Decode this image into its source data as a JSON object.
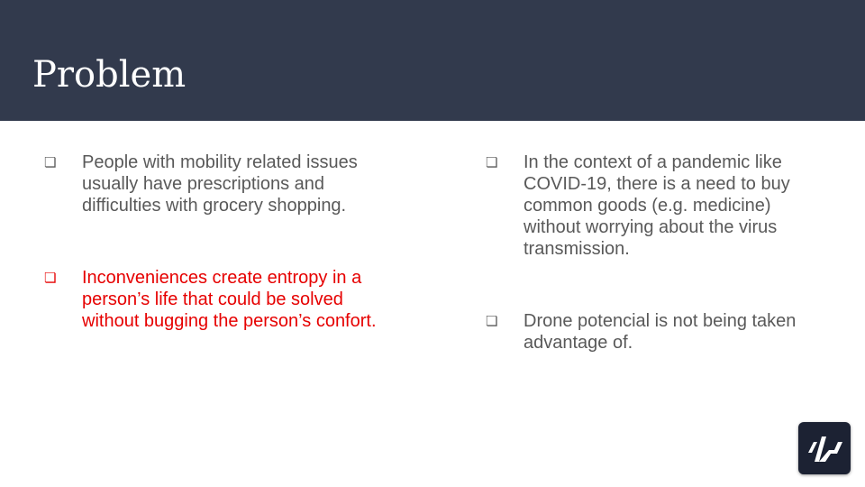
{
  "slide": {
    "title": "Problem",
    "bullets": [
      {
        "marker": "❏",
        "text": "People with mobility related issues usually have prescriptions and difficulties with grocery shopping.",
        "color": "#595959"
      },
      {
        "marker": "❏",
        "text": "Inconveniences create entropy in a person’s life that could be solved without bugging the person’s confort.",
        "color": "#e60000"
      },
      {
        "marker": "❏",
        "text": "In the context of a pandemic like COVID-19, there is a need to buy common goods (e.g. medicine) without worrying about the virus transmission.",
        "color": "#595959"
      },
      {
        "marker": "❏",
        "text": "Drone potencial is not being taken advantage of.",
        "color": "#595959"
      }
    ],
    "logo_icon": "drone-brand-logo-icon",
    "colors": {
      "header_background": "#323a4d",
      "logo_background": "#1c2233"
    }
  }
}
